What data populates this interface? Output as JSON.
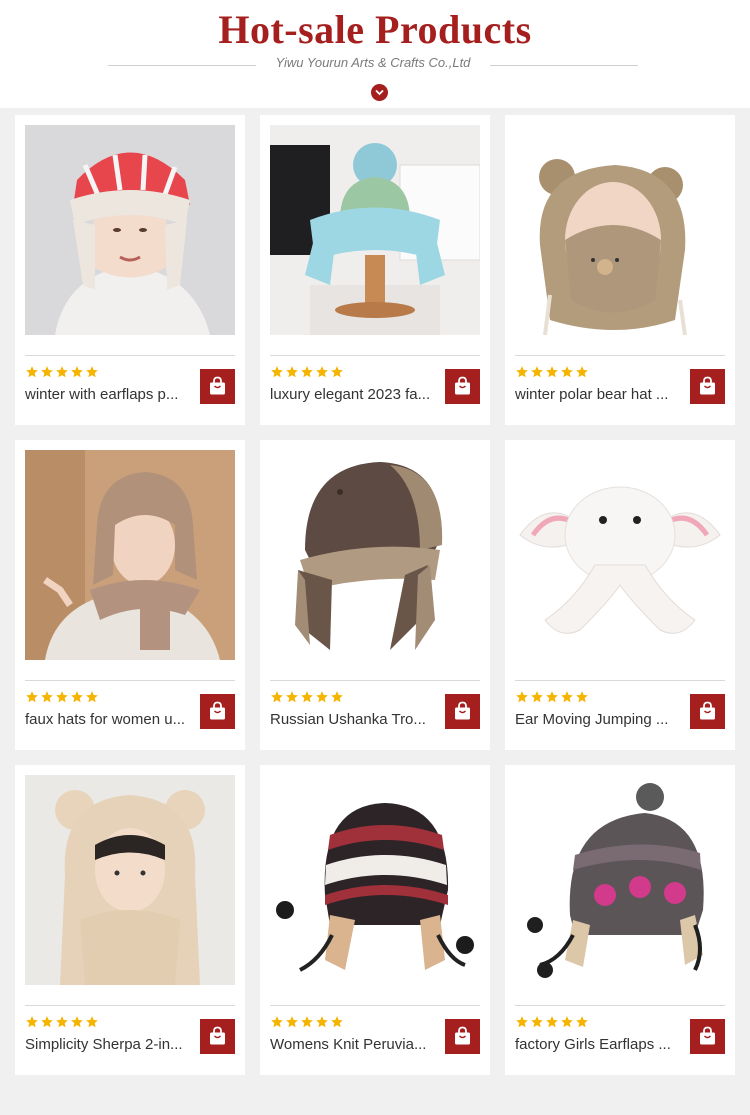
{
  "header": {
    "title": "Hot-sale Products",
    "subtitle": "Yiwu Yourun Arts & Crafts Co.,Ltd",
    "chevron_icon": "chevron-down-icon"
  },
  "colors": {
    "accent": "#a51f1f",
    "star": "#f5b400",
    "background": "#f0f0f0"
  },
  "products": [
    {
      "name": "winter with earflaps p...",
      "rating": 5,
      "cart_icon": "shopping-bag-icon",
      "image": "woman-pink-plaid-trapper-hat"
    },
    {
      "name": "luxury elegant 2023 fa...",
      "rating": 5,
      "cart_icon": "shopping-bag-icon",
      "image": "blue-faux-fur-pompom-hat-on-stand"
    },
    {
      "name": "winter polar bear hat ...",
      "rating": 5,
      "cart_icon": "shopping-bag-icon",
      "image": "girl-in-bear-ear-hood-with-mask"
    },
    {
      "name": "faux hats for women u...",
      "rating": 5,
      "cart_icon": "shopping-bag-icon",
      "image": "woman-faux-fur-hat-and-scarf"
    },
    {
      "name": "Russian Ushanka Tro...",
      "rating": 5,
      "cart_icon": "shopping-bag-icon",
      "image": "brown-ushanka-trapper-hat"
    },
    {
      "name": "Ear Moving Jumping ...",
      "rating": 5,
      "cart_icon": "shopping-bag-icon",
      "image": "white-bunny-hat-with-moving-ears"
    },
    {
      "name": "Simplicity Sherpa 2-in...",
      "rating": 5,
      "cart_icon": "shopping-bag-icon",
      "image": "woman-sherpa-bear-hood-scarf"
    },
    {
      "name": "Womens Knit Peruvia...",
      "rating": 5,
      "cart_icon": "shopping-bag-icon",
      "image": "knit-peruvian-earflap-hat"
    },
    {
      "name": "factory Girls Earflaps ...",
      "rating": 5,
      "cart_icon": "shopping-bag-icon",
      "image": "grey-snowflake-earflap-beanie"
    }
  ]
}
